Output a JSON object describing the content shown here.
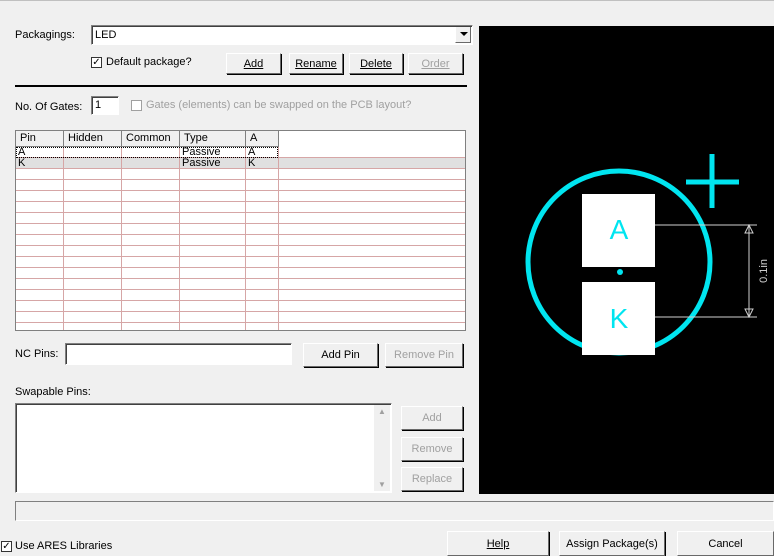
{
  "packagings": {
    "label": "Packagings:",
    "value": "LED",
    "default_label": "Default package?",
    "default_checked": true,
    "buttons": {
      "add": "Add",
      "rename": "Rename",
      "delete": "Delete",
      "order": "Order"
    }
  },
  "gates": {
    "label": "No. Of Gates:",
    "value": "1",
    "swap_label": "Gates (elements) can be swapped on the PCB layout?",
    "swap_checked": false
  },
  "pin_table": {
    "columns": [
      "Pin",
      "Hidden",
      "Common",
      "Type",
      "A"
    ],
    "rows": [
      {
        "pin": "A",
        "hidden": "",
        "common": "",
        "type": "Passive",
        "a": "A"
      },
      {
        "pin": "K",
        "hidden": "",
        "common": "",
        "type": "Passive",
        "a": "K"
      }
    ]
  },
  "nc_pins": {
    "label": "NC Pins:",
    "value": "",
    "add_pin": "Add Pin",
    "remove_pin": "Remove Pin"
  },
  "swapable": {
    "label": "Swapable Pins:",
    "add": "Add",
    "remove": "Remove",
    "replace": "Replace"
  },
  "preview": {
    "pad_a": "A",
    "pad_k": "K",
    "dimension": "0.1in",
    "colors": {
      "background": "#000000",
      "outline": "#00e5f0",
      "pad": "#ffffff",
      "dimension": "#cfcfcf"
    }
  },
  "footer": {
    "use_ares_label": "Use ARES Libraries",
    "use_ares_checked": true,
    "help": "Help",
    "assign": "Assign Package(s)",
    "cancel": "Cancel"
  }
}
